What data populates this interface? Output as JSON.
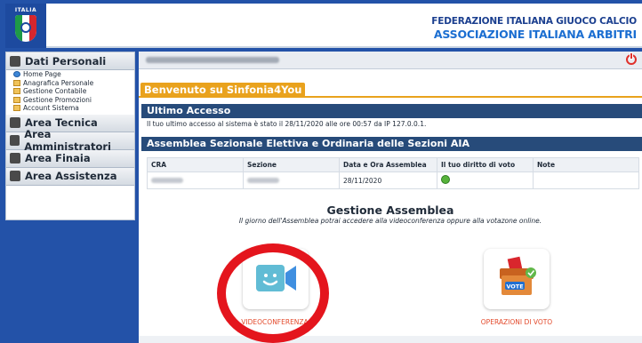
{
  "header": {
    "logo_text": "ITALIA",
    "org_line1": "FEDERAZIONE ITALIANA GIUOCO CALCIO",
    "org_line2": "ASSOCIAZIONE ITALIANA ARBITRI"
  },
  "sidebar": {
    "sections": [
      {
        "label": "Dati Personali",
        "icon": "person-card-icon"
      },
      {
        "label": "Area Tecnica",
        "icon": "book-icon"
      },
      {
        "label": "Area Amministratori",
        "icon": "book-icon"
      },
      {
        "label": "Area Finaia",
        "icon": "book-icon"
      },
      {
        "label": "Area Assistenza",
        "icon": "book-icon"
      }
    ],
    "items": [
      {
        "label": "Home Page",
        "icon": "home-icon"
      },
      {
        "label": "Anagrafica Personale",
        "icon": "folder-icon"
      },
      {
        "label": "Gestione Contabile",
        "icon": "folder-icon"
      },
      {
        "label": "Gestione Promozioni",
        "icon": "folder-icon"
      },
      {
        "label": "Account Sistema",
        "icon": "folder-icon"
      }
    ]
  },
  "userbar": {
    "power_icon": "power-icon"
  },
  "welcome": "Benvenuto su Sinfonia4You",
  "ultimo_accesso": {
    "title": "Ultimo Accesso",
    "text": "Il tuo ultimo accesso al sistema è stato il 28/11/2020 alle ore 00:57 da IP 127.0.0.1."
  },
  "assemblea": {
    "title": "Assemblea Sezionale Elettiva e Ordinaria delle Sezioni AIA",
    "columns": [
      "CRA",
      "Sezione",
      "Data e Ora Assemblea",
      "Il tuo diritto di voto",
      "Note"
    ],
    "row": {
      "data": "28/11/2020",
      "vote_status_color": "#57b33b"
    }
  },
  "gestione": {
    "title": "Gestione Assemblea",
    "subtitle": "Il giorno dell'Assemblea potrai accedere alla videoconferenza oppure alla votazone online.",
    "videoconf_label": "VIDEOCONFERENZA",
    "voto_label": "OPERAZIONI DI VOTO"
  },
  "colors": {
    "frame_blue": "#2352a8",
    "section_bar": "#274b7a",
    "accent_orange": "#e9a21d",
    "highlight_red": "#e4151d"
  }
}
